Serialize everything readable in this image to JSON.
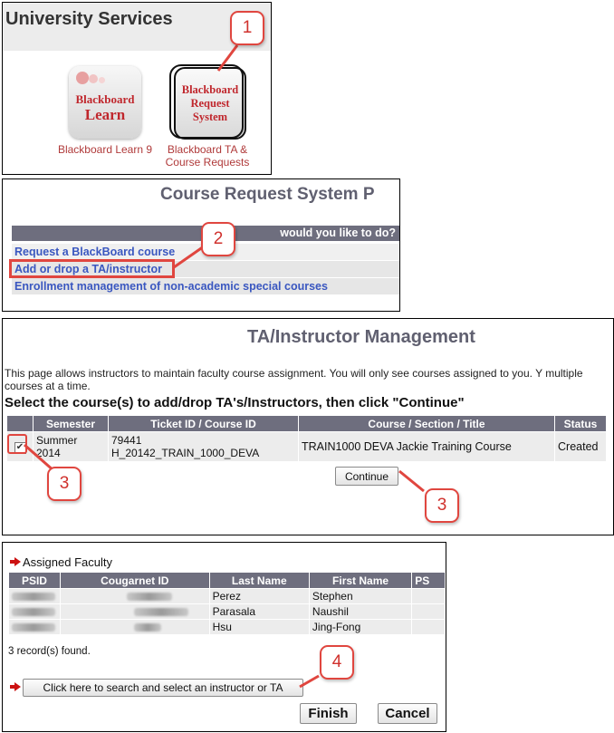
{
  "panel1": {
    "header": "University Services",
    "apps": [
      {
        "icon": "blackboard-learn-icon",
        "icon_line1": "Blackboard",
        "icon_line2": "Learn",
        "label": "Blackboard Learn 9"
      },
      {
        "icon": "blackboard-request-system-icon",
        "icon_line1": "Blackboard",
        "icon_line2": "Request",
        "icon_line3": "System",
        "label_line1": "Blackboard TA &",
        "label_line2": "Course Requests"
      }
    ]
  },
  "panel2": {
    "title": "Course Request System P",
    "bar_text": "would you like to do?",
    "links": [
      "Request a BlackBoard course",
      "Add or drop a TA/instructor",
      "Enrollment management of non-academic special courses"
    ]
  },
  "panel3": {
    "title": "TA/Instructor Management",
    "description": "This page allows instructors to maintain faculty course assignment. You will only see courses assigned to you. Y multiple courses at a time.",
    "select_prompt": "Select the course(s) to add/drop TA's/Instructors, then click \"Continue\"",
    "columns": [
      "",
      "Semester",
      "Ticket ID / Course ID",
      "Course / Section / Title",
      "Status"
    ],
    "row": {
      "checked": "✔",
      "semester_line1": "Summer",
      "semester_line2": "2014",
      "ticket_line1": "79441",
      "ticket_line2": "H_20142_TRAIN_1000_DEVA",
      "course": "TRAIN1000 DEVA Jackie Training Course",
      "status": "Created"
    },
    "continue_label": "Continue"
  },
  "panel4": {
    "assigned_label": "Assigned Faculty",
    "columns": [
      "PSID",
      "Cougarnet ID",
      "Last Name",
      "First Name",
      "PS"
    ],
    "rows": [
      {
        "last": "Perez",
        "first": "Stephen"
      },
      {
        "last": "Parasala",
        "first": "Naushil"
      },
      {
        "last": "Hsu",
        "first": "Jing-Fong"
      }
    ],
    "records_found": "3 record(s) found.",
    "search_button": "Click here to search and select an instructor or TA",
    "finish_label": "Finish",
    "cancel_label": "Cancel"
  },
  "callouts": [
    "1",
    "2",
    "3",
    "3",
    "4"
  ],
  "colors": {
    "accent_red": "#e0463f",
    "header_gray": "#6e6e7e",
    "link_blue": "#3a57c0",
    "brand_red": "#c0272d"
  }
}
